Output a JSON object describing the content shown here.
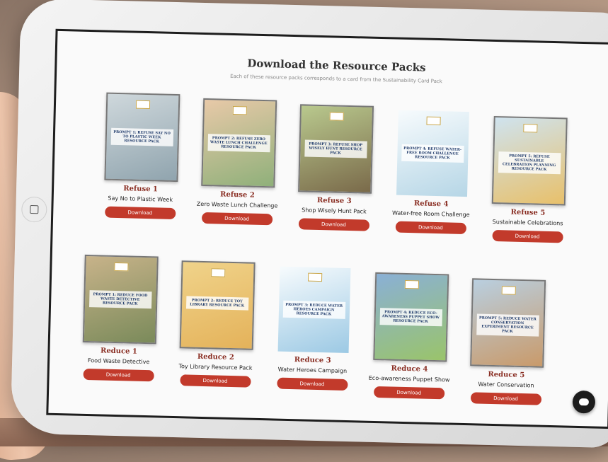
{
  "page": {
    "title": "Download the Resource Packs",
    "subtitle": "Each of these resource packs corresponds to a card from the Sustainability Card Pack"
  },
  "cards": [
    {
      "label": "Refuse 1",
      "name": "Say No to Plastic Week",
      "cover_text": "PROMPT 1: REFUSE SAY NO TO PLASTIC WEEK RESOURCE PACK",
      "colors": [
        "#cfd8dc",
        "#90a4ae"
      ],
      "download": "Download"
    },
    {
      "label": "Refuse 2",
      "name": "Zero Waste Lunch Challenge",
      "cover_text": "PROMPT 2: REFUSE ZERO WASTE LUNCH CHALLENGE RESOURCE PACK",
      "colors": [
        "#e8c9a8",
        "#8fb07a"
      ],
      "download": "Download"
    },
    {
      "label": "Refuse 3",
      "name": "Shop Wisely Hunt Pack",
      "cover_text": "PROMPT 3: REFUSE SHOP WISELY HUNT RESOURCE PACK",
      "colors": [
        "#b9c98e",
        "#7a6a4a"
      ],
      "download": "Download"
    },
    {
      "label": "Refuse 4",
      "name": "Water-free Room Challenge",
      "cover_text": "PROMPT 4: REFUSE WATER-FREE ROOM CHALLENGE RESOURCE PACK",
      "colors": [
        "#f7fbfd",
        "#b6d6e6"
      ],
      "download": "Download"
    },
    {
      "label": "Refuse 5",
      "name": "Sustainable Celebrations",
      "cover_text": "PROMPT 5: REFUSE SUSTAINABLE CELEBRATION PLANNING RESOURCE PACK",
      "colors": [
        "#cfe3ef",
        "#e8c06a"
      ],
      "download": "Download"
    },
    {
      "label": "Reduce 1",
      "name": "Food Waste Detective",
      "cover_text": "PROMPT 1: REDUCE FOOD WASTE DETECTIVE RESOURCE PACK",
      "colors": [
        "#c8b38a",
        "#7a8a5a"
      ],
      "download": "Download"
    },
    {
      "label": "Reduce 2",
      "name": "Toy Library Resource Pack",
      "cover_text": "PROMPT 2: REDUCE TOY LIBRARY RESOURCE PACK",
      "colors": [
        "#f0d38a",
        "#e4b25a"
      ],
      "download": "Download"
    },
    {
      "label": "Reduce 3",
      "name": "Water Heroes Campaign",
      "cover_text": "PROMPT 3: REDUCE WATER HEROES CAMPAIGN RESOURCE PACK",
      "colors": [
        "#f7fbfd",
        "#9cc9e4"
      ],
      "download": "Download"
    },
    {
      "label": "Reduce 4",
      "name": "Eco-awareness Puppet Show",
      "cover_text": "PROMPT 4: REDUCE ECO-AWARENESS PUPPET SHOW RESOURCE PACK",
      "colors": [
        "#8ab0d6",
        "#9ac46a"
      ],
      "download": "Download"
    },
    {
      "label": "Reduce 5",
      "name": "Water Conservation",
      "cover_text": "PROMPT 5: REDUCE WATER CONSERVATION EXPERIMENT RESOURCE PACK",
      "colors": [
        "#b9cfe0",
        "#c99a6a"
      ],
      "download": "Download"
    }
  ],
  "chat_button": {
    "icon": "chat-icon"
  }
}
